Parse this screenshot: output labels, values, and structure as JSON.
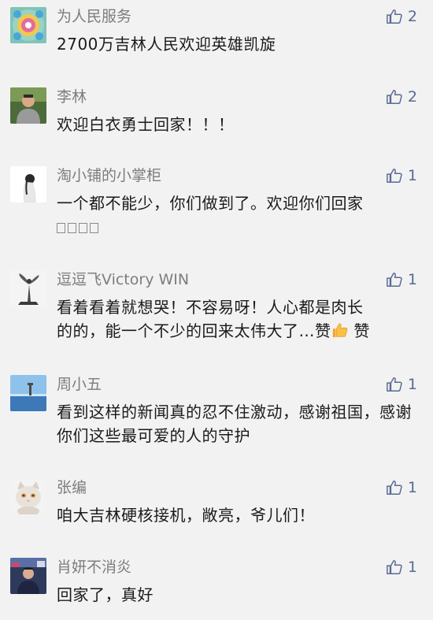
{
  "comments": [
    {
      "name": "为人民服务",
      "text": "2700万吉林人民欢迎英雄凯旋",
      "likes": "2",
      "avatar_icon": "lotus-icon"
    },
    {
      "name": "李林",
      "text": "欢迎白衣勇士回家！！！",
      "likes": "2",
      "avatar_icon": "person-photo-icon"
    },
    {
      "name": "淘小铺的小掌柜",
      "text": "一个都不能少，你们做到了。欢迎你们回家",
      "likes": "1",
      "avatar_icon": "girl-silhouette-icon"
    },
    {
      "name": "逗逗飞Victory WIN",
      "text_line1": "看着看着就想哭！不容易呀！人心都是肉长",
      "text_line2a": "的的，能一个不少的回来太伟大了…赞",
      "text_line2b": " 赞",
      "likes": "1",
      "avatar_icon": "statue-icon"
    },
    {
      "name": "周小五",
      "text": "看到这样的新闻真的忍不住激动，感谢祖国，感谢你们这些最可爱的人的守护",
      "likes": "1",
      "avatar_icon": "sea-lighthouse-icon"
    },
    {
      "name": "张编",
      "text": "咱大吉林硬核接机，敞亮，爷儿们！",
      "likes": "1",
      "avatar_icon": "cat-icon"
    },
    {
      "name": "肖妍不消炎",
      "text": "回家了，真好",
      "likes": "1",
      "avatar_icon": "person-photo-icon"
    }
  ],
  "colors": {
    "background": "#f2f2f2",
    "name": "#7d7d7d",
    "text": "#1a1a1a",
    "like": "#576b95"
  }
}
